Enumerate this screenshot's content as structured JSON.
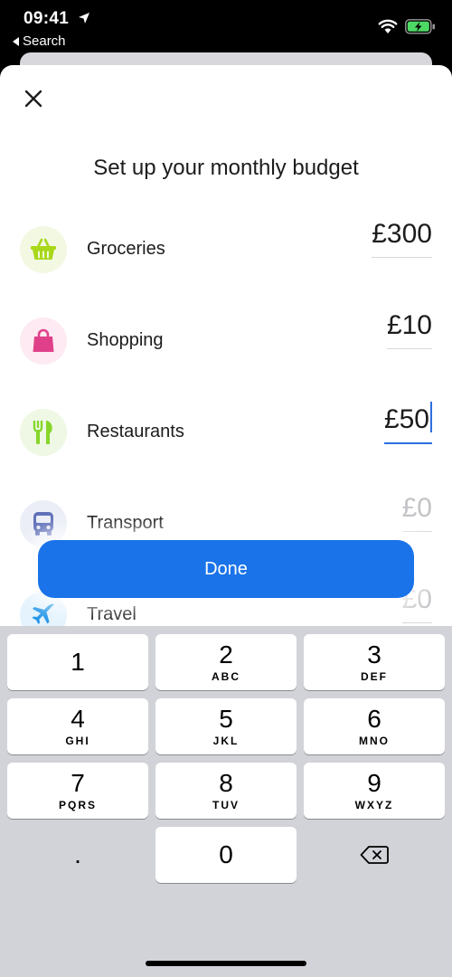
{
  "status_bar": {
    "time": "09:41",
    "back_label": "Search"
  },
  "sheet": {
    "title": "Set up your monthly budget",
    "categories": [
      {
        "label": "Groceries",
        "amount": "£300",
        "icon": "basket-icon",
        "icon_color": "#a8d81a",
        "icon_bg": "#f3f8e2"
      },
      {
        "label": "Shopping",
        "amount": "£10",
        "icon": "shopping-bag-icon",
        "icon_color": "#e0408a",
        "icon_bg": "#fdeaf2"
      },
      {
        "label": "Restaurants",
        "amount": "£50",
        "icon": "cutlery-icon",
        "icon_color": "#86d62a",
        "icon_bg": "#eef8e4"
      },
      {
        "label": "Transport",
        "amount": "£0",
        "icon": "bus-icon",
        "icon_color": "#5e6fb8",
        "icon_bg": "#eceef7"
      },
      {
        "label": "Travel",
        "amount": "£0",
        "icon": "plane-icon",
        "icon_color": "#2196e8",
        "icon_bg": "#e4f3fd"
      }
    ],
    "done_label": "Done"
  },
  "keyboard": {
    "keys": [
      {
        "digit": "1",
        "letters": ""
      },
      {
        "digit": "2",
        "letters": "ABC"
      },
      {
        "digit": "3",
        "letters": "DEF"
      },
      {
        "digit": "4",
        "letters": "GHI"
      },
      {
        "digit": "5",
        "letters": "JKL"
      },
      {
        "digit": "6",
        "letters": "MNO"
      },
      {
        "digit": "7",
        "letters": "PQRS"
      },
      {
        "digit": "8",
        "letters": "TUV"
      },
      {
        "digit": "9",
        "letters": "WXYZ"
      }
    ],
    "decimal": ".",
    "zero": "0"
  },
  "colors": {
    "accent": "#1a73e8",
    "keyboard_bg": "#d1d3d9"
  }
}
